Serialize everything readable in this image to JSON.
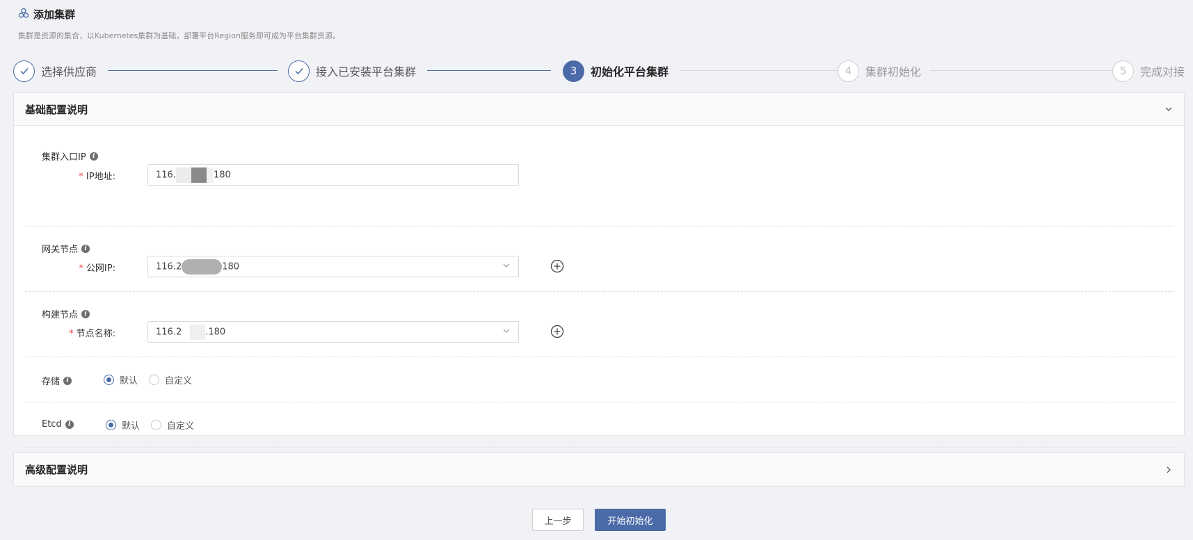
{
  "header": {
    "title": "添加集群",
    "description": "集群是资源的集合，以Kubernetes集群为基础，部署平台Region服务即可成为平台集群资源。",
    "icon": "cluster-icon"
  },
  "steps": [
    {
      "number": "1",
      "label": "选择供应商",
      "status": "done"
    },
    {
      "number": "2",
      "label": "接入已安装平台集群",
      "status": "done"
    },
    {
      "number": "3",
      "label": "初始化平台集群",
      "status": "active"
    },
    {
      "number": "4",
      "label": "集群初始化",
      "status": "wait"
    },
    {
      "number": "5",
      "label": "完成对接",
      "status": "wait"
    }
  ],
  "basic_panel": {
    "title": "基础配置说明",
    "entry_ip": {
      "section_title": "集群入口IP",
      "label": "IP地址",
      "value_prefix": "116.",
      "value_suffix": "180"
    },
    "gateway": {
      "section_title": "网关节点",
      "label": "公网IP",
      "value_prefix": "116.2",
      "value_suffix": "180"
    },
    "build": {
      "section_title": "构建节点",
      "label": "节点名称",
      "value_prefix": "116.2",
      "value_suffix": ".180"
    },
    "storage": {
      "section_title": "存储",
      "options": [
        "默认",
        "自定义"
      ],
      "selected": "默认"
    },
    "etcd": {
      "section_title": "Etcd",
      "options": [
        "默认",
        "自定义"
      ],
      "selected": "默认"
    }
  },
  "advanced_panel": {
    "title": "高级配置说明"
  },
  "footer": {
    "prev_label": "上一步",
    "start_label": "开始初始化"
  },
  "colors": {
    "primary": "#4a6aa8",
    "required": "#e5484d"
  }
}
